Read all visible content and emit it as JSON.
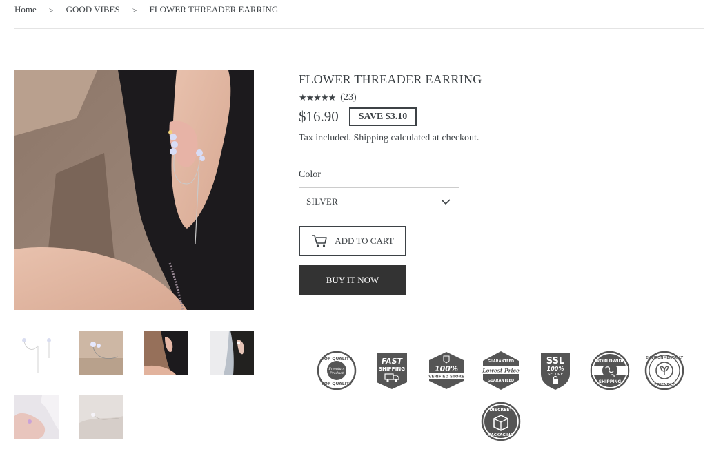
{
  "breadcrumb": {
    "home": "Home",
    "separator": ">",
    "collection": "GOOD VIBES",
    "current": "FLOWER THREADER EARRING"
  },
  "product": {
    "title": "FLOWER THREADER EARRING",
    "rating_stars": "★★★★★",
    "rating_value": 5,
    "rating_count": "(23)",
    "price": "$16.90",
    "save": "SAVE $3.10",
    "tax_note": "Tax included. Shipping calculated at checkout.",
    "color_label": "Color",
    "color_selected": "SILVER",
    "add_to_cart": "ADD TO CART",
    "buy_now": "BUY IT NOW"
  },
  "images": {
    "main": "main-product-photo",
    "thumbnails": [
      "thumb-1",
      "thumb-2",
      "thumb-3",
      "thumb-4",
      "thumb-5",
      "thumb-6"
    ]
  },
  "trust_badges": {
    "top_quality": {
      "top": "TOP QUALITY",
      "center_1": "Premium",
      "center_2": "Product",
      "bottom": "TOP QUALITY"
    },
    "fast_shipping": {
      "line1": "FAST",
      "line2": "SHIPPING"
    },
    "verified_store": {
      "line1": "100%",
      "line2": "VERIFIED STORE"
    },
    "lowest_price": {
      "top": "GUARANTEED",
      "center": "Lowest Price",
      "bottom": "GUARANTEED"
    },
    "ssl": {
      "line1": "SSL",
      "line2": "100%",
      "line3": "SECURE"
    },
    "worldwide": {
      "top": "WORLDWIDE",
      "bottom": "SHIPPING"
    },
    "eco": {
      "top": "ENVIRONMENTALLY",
      "bottom": "FRIENDLY"
    },
    "discreet": {
      "top": "DISCREET",
      "bottom": "PACKAGING"
    }
  },
  "colors": {
    "text": "#3d4246",
    "badge_fill": "#5a5a5a",
    "button_dark": "#333333"
  }
}
